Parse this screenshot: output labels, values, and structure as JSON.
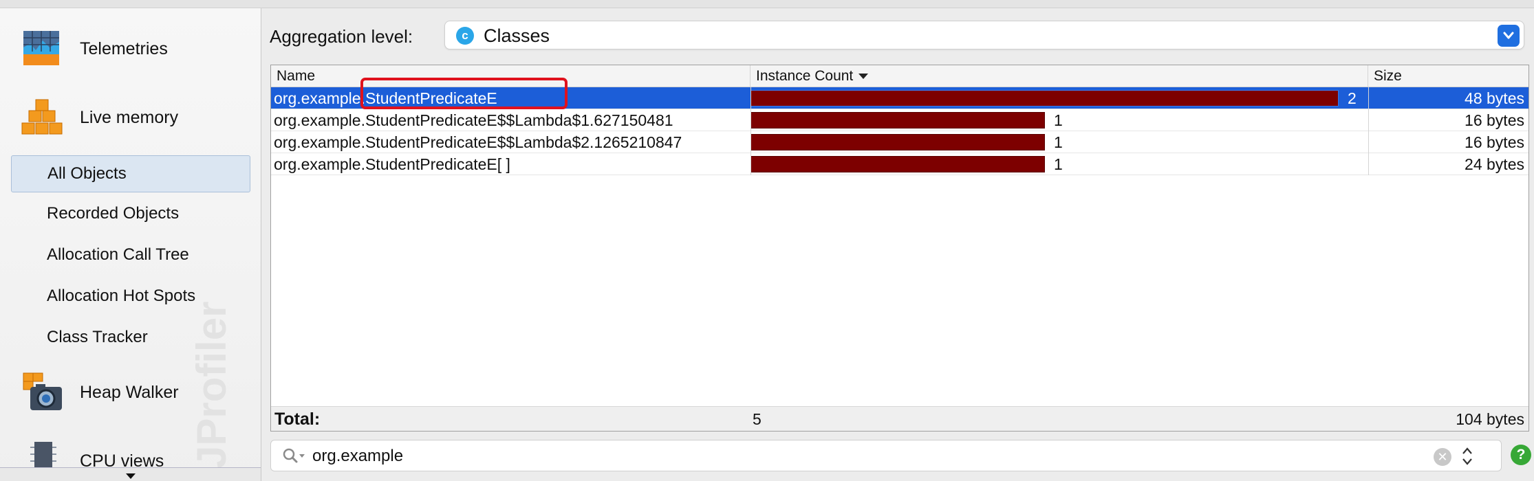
{
  "sidebar": {
    "categories": [
      {
        "label": "Telemetries",
        "icon": "telemetries-icon"
      },
      {
        "label": "Live memory",
        "icon": "live-memory-icon"
      },
      {
        "label": "Heap Walker",
        "icon": "heap-walker-icon"
      },
      {
        "label": "CPU views",
        "icon": "cpu-views-icon"
      }
    ],
    "items": [
      {
        "label": "All Objects",
        "selected": true
      },
      {
        "label": "Recorded Objects"
      },
      {
        "label": "Allocation Call Tree"
      },
      {
        "label": "Allocation Hot Spots"
      },
      {
        "label": "Class Tracker"
      }
    ],
    "watermark": "JProfiler"
  },
  "aggregation": {
    "label": "Aggregation level:",
    "value": "Classes",
    "icon_letter": "c"
  },
  "table": {
    "columns": [
      "Name",
      "Instance Count",
      "Size"
    ],
    "sorted_column": "Instance Count",
    "rows": [
      {
        "name": "org.example.StudentPredicateE",
        "count": "2",
        "size": "48 bytes",
        "selected": true
      },
      {
        "name": "org.example.StudentPredicateE$$Lambda$1.627150481",
        "count": "1",
        "size": "16 bytes"
      },
      {
        "name": "org.example.StudentPredicateE$$Lambda$2.1265210847",
        "count": "1",
        "size": "16 bytes"
      },
      {
        "name": "org.example.StudentPredicateE[ ]",
        "count": "1",
        "size": "24 bytes"
      }
    ],
    "total": {
      "label": "Total:",
      "count": "5",
      "size": "104 bytes"
    }
  },
  "filter": {
    "value": "org.example"
  },
  "colors": {
    "selection": "#1c5ed8",
    "bar": "#7d0000",
    "highlight": "#e0121d"
  }
}
